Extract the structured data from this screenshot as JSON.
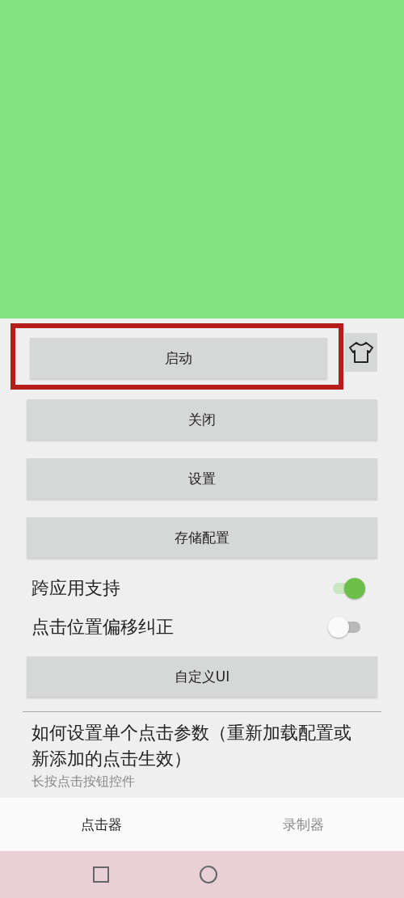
{
  "main_button": {
    "label": "启动",
    "highlighted": true
  },
  "buttons": [
    {
      "label": "关闭"
    },
    {
      "label": "设置"
    },
    {
      "label": "存储配置"
    }
  ],
  "switches": [
    {
      "label": "跨应用支持",
      "on": true
    },
    {
      "label": "点击位置偏移纠正",
      "on": false
    }
  ],
  "custom_button": {
    "label": "自定义UI"
  },
  "help": {
    "title": "如何设置单个点击参数（重新加载配置或新添加的点击生效）",
    "hint": "长按点击按钮控件"
  },
  "tabs": [
    {
      "label": "点击器",
      "selected": true
    },
    {
      "label": "录制器",
      "selected": false
    }
  ]
}
